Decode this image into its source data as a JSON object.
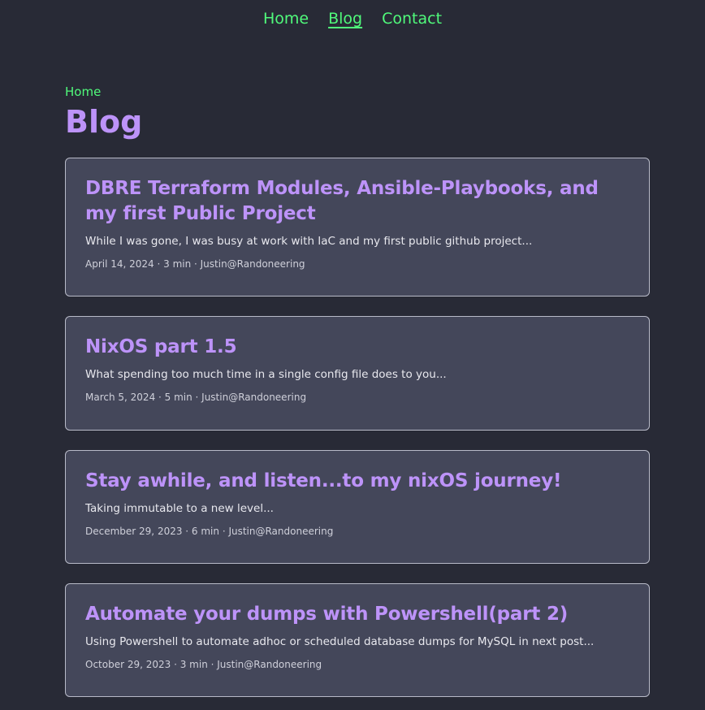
{
  "nav": {
    "items": [
      {
        "label": "Home"
      },
      {
        "label": "Blog"
      },
      {
        "label": "Contact"
      }
    ]
  },
  "breadcrumb": {
    "home_label": "Home"
  },
  "page": {
    "title": "Blog"
  },
  "posts": [
    {
      "title": "DBRE Terraform Modules, Ansible-Playbooks, and my first Public Project",
      "summary": "While I was gone, I was busy at work with IaC and my first public github project...",
      "meta": "April 14, 2024 · 3 min · Justin@Randoneering"
    },
    {
      "title": "NixOS part 1.5",
      "summary": "What spending too much time in a single config file does to you...",
      "meta": "March 5, 2024 · 5 min · Justin@Randoneering"
    },
    {
      "title": "Stay awhile, and listen...to my nixOS journey!",
      "summary": "Taking immutable to a new level...",
      "meta": "December 29, 2023 · 6 min · Justin@Randoneering"
    },
    {
      "title": "Automate your dumps with Powershell(part 2)",
      "summary": "Using Powershell to automate adhoc or scheduled database dumps for MySQL in next post...",
      "meta": "October 29, 2023 · 3 min · Justin@Randoneering"
    }
  ],
  "colors": {
    "background": "#282a36",
    "card": "#44475a",
    "accent_green": "#50fa7b",
    "accent_purple": "#bd93f9"
  }
}
